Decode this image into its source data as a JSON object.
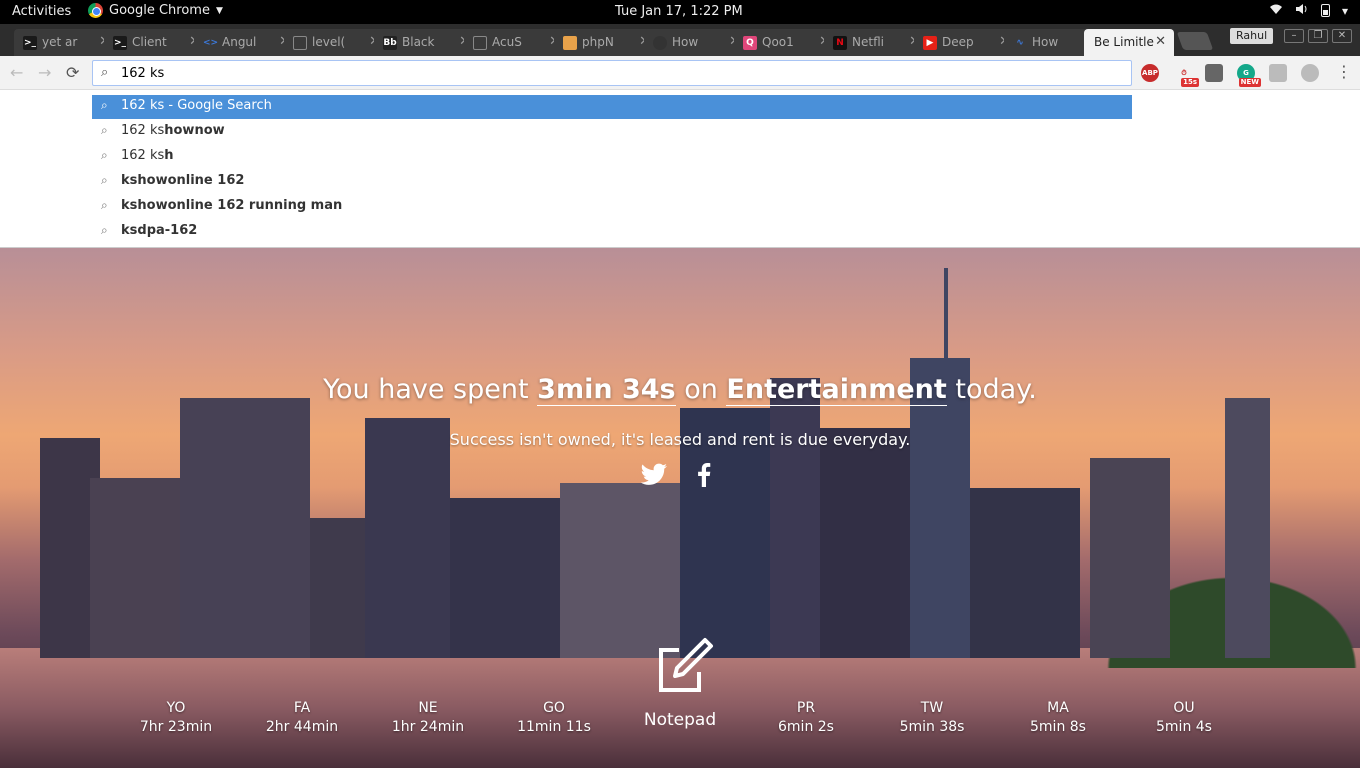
{
  "system_bar": {
    "activities": "Activities",
    "app_name": "Google Chrome",
    "clock": "Tue Jan 17,  1:22 PM"
  },
  "tabs": [
    {
      "label": "yet ar",
      "icon": "terminal-icon",
      "color": "#1a1a1a"
    },
    {
      "label": "Client",
      "icon": "terminal-icon",
      "color": "#1a1a1a"
    },
    {
      "label": "Angul",
      "icon": "code-icon",
      "color": "#3c78d8"
    },
    {
      "label": "level(",
      "icon": "file-icon",
      "color": "#888888"
    },
    {
      "label": "Black",
      "icon": "blackboard-icon",
      "color": "#222222"
    },
    {
      "label": "AcuS",
      "icon": "file-icon",
      "color": "#888888"
    },
    {
      "label": "phpN",
      "icon": "phpmyadmin-icon",
      "color": "#e8a24a"
    },
    {
      "label": "How",
      "icon": "github-icon",
      "color": "#333333"
    },
    {
      "label": "Qoo1",
      "icon": "quora-icon",
      "color": "#e0467a"
    },
    {
      "label": "Netfli",
      "icon": "netflix-icon",
      "color": "#e50914"
    },
    {
      "label": "Deep",
      "icon": "youtube-icon",
      "color": "#e62117"
    },
    {
      "label": "How",
      "icon": "pulse-icon",
      "color": "#3c78d8"
    },
    {
      "label": "Be Limitle",
      "icon": "",
      "color": "#f2f2f2",
      "active": true
    }
  ],
  "profile_name": "Rahul",
  "omnibox": {
    "value": "162 ks"
  },
  "extensions": [
    {
      "label": "ABP",
      "icon": "adblock-plus-icon",
      "color": "#c72c2c"
    },
    {
      "label": "15s",
      "icon": "timer-extension-icon",
      "color": "#cc3333"
    },
    {
      "label": "",
      "icon": "ghost-extension-icon",
      "color": "#666666"
    },
    {
      "label": "NEW",
      "icon": "grammarly-icon",
      "color": "#14a88a"
    },
    {
      "label": "",
      "icon": "shield-extension-icon",
      "color": "#bbbbbb"
    },
    {
      "label": "",
      "icon": "circle-extension-icon",
      "color": "#bbbbbb"
    }
  ],
  "suggestions": [
    {
      "plain": "162 ks - Google Search",
      "bold": "",
      "selected": true
    },
    {
      "plain": "162 ks",
      "bold": "hownow"
    },
    {
      "plain": "162 ks",
      "bold": "h"
    },
    {
      "plain": "",
      "bold": "kshowonline 162"
    },
    {
      "plain": "",
      "bold": "kshowonline 162 running man"
    },
    {
      "plain": "",
      "bold": "ksdpa-162"
    }
  ],
  "main": {
    "headline_prefix": "You have spent ",
    "headline_time": "3min 34s",
    "headline_mid": " on ",
    "headline_category": "Entertainment",
    "headline_suffix": " today.",
    "quote": "Success isn't owned, it's leased and rent is due everyday.",
    "notepad_label": "Notepad",
    "stats": [
      {
        "code": "YO",
        "duration": "7hr 23min"
      },
      {
        "code": "FA",
        "duration": "2hr 44min"
      },
      {
        "code": "NE",
        "duration": "1hr 24min"
      },
      {
        "code": "GO",
        "duration": "11min 11s"
      },
      {
        "code": "PR",
        "duration": "6min 2s"
      },
      {
        "code": "TW",
        "duration": "5min 38s"
      },
      {
        "code": "MA",
        "duration": "5min 8s"
      },
      {
        "code": "OU",
        "duration": "5min 4s"
      }
    ]
  }
}
